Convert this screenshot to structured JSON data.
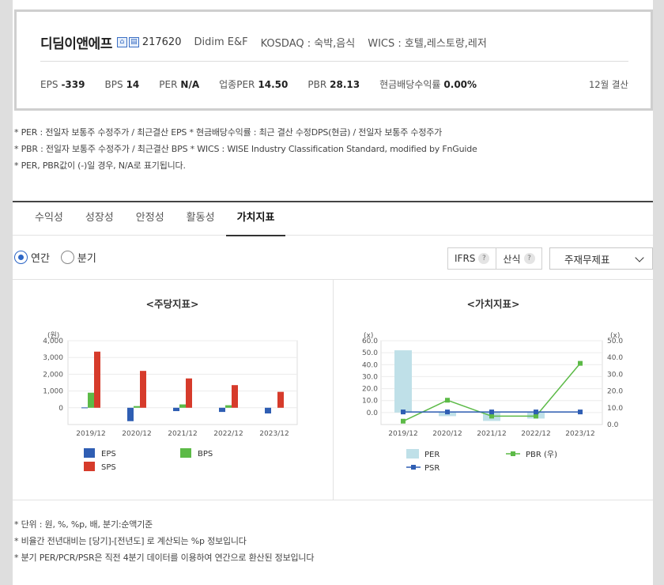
{
  "company": {
    "name": "디딤이앤에프",
    "code": "217620",
    "english_name": "Didim E&F",
    "market": "KOSDAQ : 숙박,음식",
    "wics": "WICS : 호텔,레스토랑,레저"
  },
  "metrics": [
    {
      "label": "EPS",
      "value": "-339"
    },
    {
      "label": "BPS",
      "value": "14"
    },
    {
      "label": "PER",
      "value": "N/A"
    },
    {
      "label": "업종PER",
      "value": "14.50"
    },
    {
      "label": "PBR",
      "value": "28.13"
    },
    {
      "label": "현금배당수익률",
      "value": "0.00%"
    }
  ],
  "fiscal": "12월 결산",
  "notes_top": [
    "* PER : 전일자 보통주 수정주가 / 최근결산 EPS * 현금배당수익률 : 최근 결산 수정DPS(현금) / 전일자 보통주 수정주가",
    "* PBR : 전일자 보통주 수정주가 / 최근결산 BPS * WICS : WISE Industry Classification Standard, modified by FnGuide",
    "* PER, PBR값이 (-)일 경우, N/A로 표기됩니다."
  ],
  "tabs": [
    "수익성",
    "성장성",
    "안정성",
    "활동성",
    "가치지표"
  ],
  "active_tab": "가치지표",
  "period": {
    "annual": "연간",
    "quarter": "분기",
    "selected": "annual"
  },
  "options": {
    "ifrs": "IFRS",
    "calc": "산식",
    "help": "?",
    "select_value": "주재무제표"
  },
  "notes_bottom": [
    "* 단위 : 원, %, %p, 배, 분기:순액기준",
    "* 비율간 전년대비는 [당기]-[전년도] 로 계산되는 %p 정보입니다",
    "* 분기 PER/PCR/PSR은 직전 4분기 데이터를 이용하여 연간으로 환산된 정보입니다"
  ],
  "chart_data": [
    {
      "type": "bar",
      "title": "<주당지표>",
      "ylabel": "(원)",
      "ylim": [
        -1000,
        4000
      ],
      "yticks": [
        "4,000",
        "3,000",
        "2,000",
        "1,000",
        "0"
      ],
      "categories": [
        "2019/12",
        "2020/12",
        "2021/12",
        "2022/12",
        "2023/12"
      ],
      "series": [
        {
          "name": "EPS",
          "color": "#2f5eb3",
          "values": [
            20,
            -800,
            -200,
            -250,
            -339
          ]
        },
        {
          "name": "BPS",
          "color": "#5cba47",
          "values": [
            900,
            100,
            200,
            150,
            null
          ]
        },
        {
          "name": "SPS",
          "color": "#d63b2b",
          "values": [
            3350,
            2200,
            1750,
            1350,
            950
          ]
        }
      ],
      "legend": "bottom"
    },
    {
      "type": "bar-line",
      "title": "<가치지표>",
      "ylabel_left": "(x)",
      "ylabel_right": "(x)",
      "ylim_left": [
        -10,
        60
      ],
      "ylim_right": [
        0,
        50
      ],
      "yticks_left": [
        "60.0",
        "50.0",
        "40.0",
        "30.0",
        "20.0",
        "10.0",
        "0.0"
      ],
      "yticks_right": [
        "50.0",
        "40.0",
        "30.0",
        "20.0",
        "10.0",
        "0.0"
      ],
      "categories": [
        "2019/12",
        "2020/12",
        "2021/12",
        "2022/12",
        "2023/12"
      ],
      "series": [
        {
          "name": "PER",
          "kind": "bar",
          "axis": "left",
          "color": "#bfe0e8",
          "values": [
            52,
            -3,
            -7,
            -5,
            null
          ]
        },
        {
          "name": "PBR (우)",
          "kind": "line",
          "axis": "right",
          "color": "#5cba47",
          "values": [
            2,
            14.5,
            5,
            5,
            36.5
          ]
        },
        {
          "name": "PSR",
          "kind": "line",
          "axis": "left",
          "color": "#2f5eb3",
          "values": [
            0.5,
            0.5,
            0.5,
            0.5,
            0.5
          ]
        }
      ],
      "legend": "bottom"
    }
  ]
}
